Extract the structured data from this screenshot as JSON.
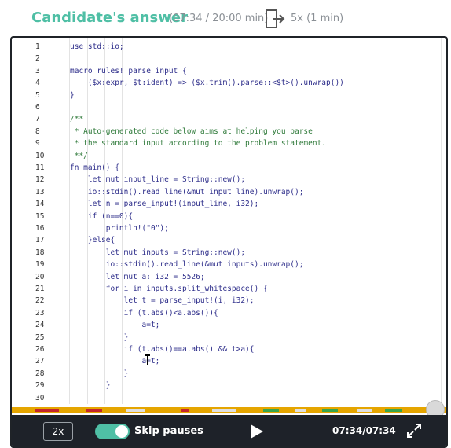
{
  "header": {
    "title": "Candidate's answer",
    "time": "(07:34 / 20:00 min)",
    "speed_info": "5x (1 min)",
    "exit_icon": "exit-icon"
  },
  "code": {
    "lines": [
      {
        "n": "1",
        "t": "use std::io;"
      },
      {
        "n": "2",
        "t": ""
      },
      {
        "n": "3",
        "t": "macro_rules! parse_input {"
      },
      {
        "n": "4",
        "t": "    ($x:expr, $t:ident) => ($x.trim().parse::<$t>().unwrap())"
      },
      {
        "n": "5",
        "t": "}"
      },
      {
        "n": "6",
        "t": ""
      },
      {
        "n": "7",
        "t": "/**"
      },
      {
        "n": "8",
        "t": " * Auto-generated code below aims at helping you parse"
      },
      {
        "n": "9",
        "t": " * the standard input according to the problem statement."
      },
      {
        "n": "10",
        "t": " **/"
      },
      {
        "n": "11",
        "t": "fn main() {"
      },
      {
        "n": "12",
        "t": "    let mut input_line = String::new();"
      },
      {
        "n": "13",
        "t": "    io::stdin().read_line(&mut input_line).unwrap();"
      },
      {
        "n": "14",
        "t": "    let n = parse_input!(input_line, i32);"
      },
      {
        "n": "15",
        "t": "    if (n==0){"
      },
      {
        "n": "16",
        "t": "        println!(\"0\");"
      },
      {
        "n": "17",
        "t": "    }else{"
      },
      {
        "n": "18",
        "t": "        let mut inputs = String::new();"
      },
      {
        "n": "19",
        "t": "        io::stdin().read_line(&mut inputs).unwrap();"
      },
      {
        "n": "20",
        "t": "        let mut a: i32 = 5526;"
      },
      {
        "n": "21",
        "t": "        for i in inputs.split_whitespace() {"
      },
      {
        "n": "22",
        "t": "            let t = parse_input!(i, i32);"
      },
      {
        "n": "23",
        "t": "            if (t.abs()<a.abs()){"
      },
      {
        "n": "24",
        "t": "                a=t;"
      },
      {
        "n": "25",
        "t": "            }"
      },
      {
        "n": "26",
        "t": "            if (t.abs()==a.abs() && t>a){"
      },
      {
        "n": "27",
        "t": "                a=t;"
      },
      {
        "n": "28",
        "t": "            }"
      },
      {
        "n": "29",
        "t": "        }"
      },
      {
        "n": "30",
        "t": ""
      }
    ]
  },
  "controls": {
    "speed": "2x",
    "skip_pauses": "Skip pauses",
    "skip_pauses_on": true,
    "clock": "07:34/07:34",
    "progress": 1.0
  },
  "colors": {
    "accent": "#4fbfa5",
    "timeline": "#e5a500",
    "controls_bg": "#1e2229"
  }
}
